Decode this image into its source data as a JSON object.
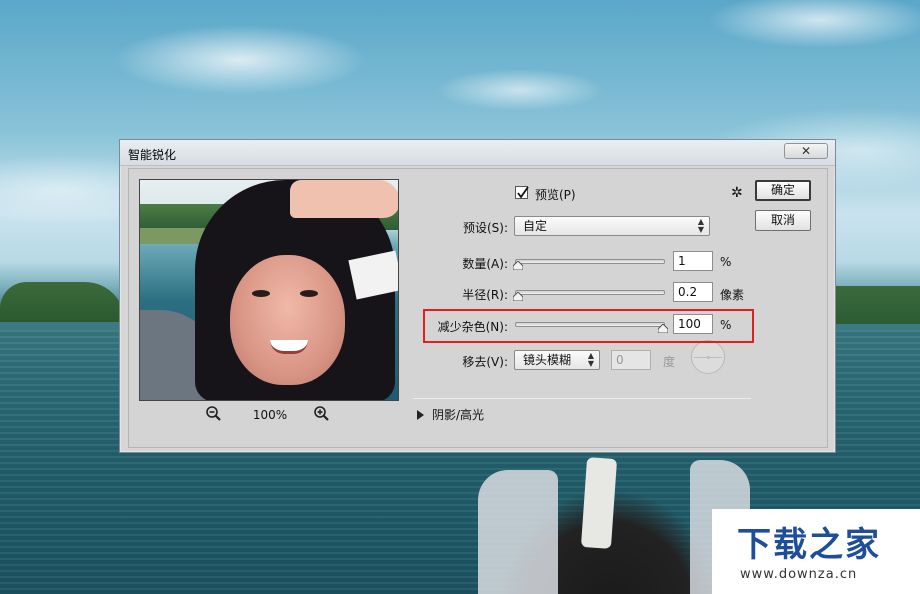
{
  "dialog": {
    "title": "智能锐化",
    "close_glyph": "✕",
    "buttons": {
      "ok": "确定",
      "cancel": "取消"
    }
  },
  "preview": {
    "zoom_level": "100%",
    "zoom_out_icon": "zoom-out-icon",
    "zoom_in_icon": "zoom-in-icon"
  },
  "controls": {
    "preview_checkbox": {
      "label": "预览(P)",
      "checked": true
    },
    "gear_glyph": "✲",
    "preset": {
      "label": "预设(S):",
      "value": "自定"
    },
    "amount": {
      "label": "数量(A):",
      "value": "1",
      "unit": "%",
      "slider_fraction": 0.0
    },
    "radius": {
      "label": "半径(R):",
      "value": "0.2",
      "unit": "像素",
      "slider_fraction": 0.0
    },
    "reduce_noise": {
      "label": "减少杂色(N):",
      "value": "100",
      "unit": "%",
      "slider_fraction": 1.0
    },
    "remove": {
      "label": "移去(V):",
      "value": "镜头模糊",
      "angle_value": "0",
      "angle_unit": "度"
    },
    "shadows_highlights": {
      "label": "阴影/高光"
    }
  },
  "watermark": {
    "main": "下载之家",
    "sub": "www.downza.cn"
  },
  "colors": {
    "highlight_box": "#e02020",
    "watermark_text": "#1e4e9a"
  }
}
